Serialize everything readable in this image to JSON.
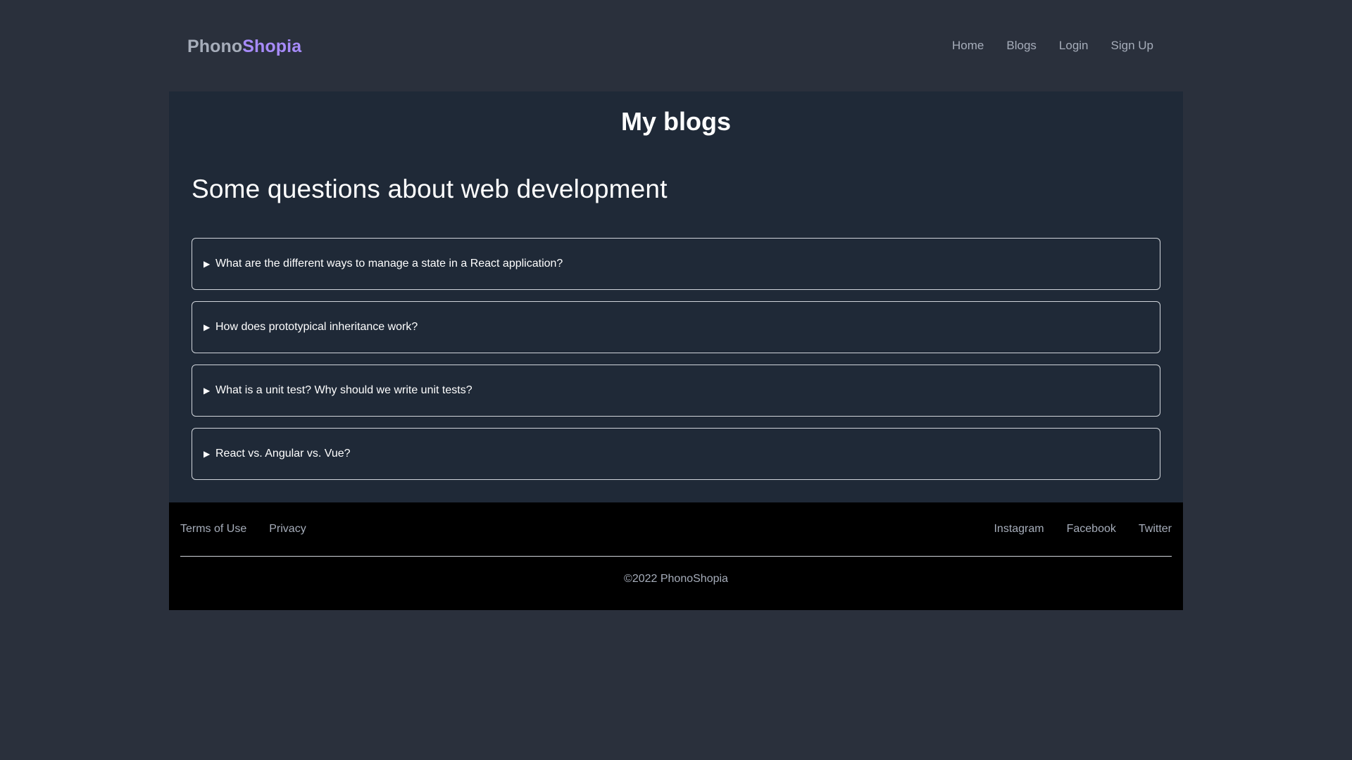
{
  "header": {
    "brand_part1": "Phono",
    "brand_part2": "Shopia",
    "nav": [
      "Home",
      "Blogs",
      "Login",
      "Sign Up"
    ]
  },
  "main": {
    "title": "My blogs",
    "section_title": "Some questions about web development",
    "faq_arrow": "▶",
    "faqs": [
      "What are the different ways to manage a state in a React application?",
      "How does prototypical inheritance work?",
      "What is a unit test? Why should we write unit tests?",
      "React vs. Angular vs. Vue?"
    ]
  },
  "footer": {
    "left_links": [
      "Terms of Use",
      "Privacy"
    ],
    "right_links": [
      "Instagram",
      "Facebook",
      "Twitter"
    ],
    "copyright": "©2022 PhonoShopia"
  },
  "colors": {
    "page_bg": "#2a303c",
    "main_bg": "#1f2937",
    "footer_bg": "#000000",
    "brand_accent": "#a78bfa",
    "muted_text": "#a6adba"
  }
}
